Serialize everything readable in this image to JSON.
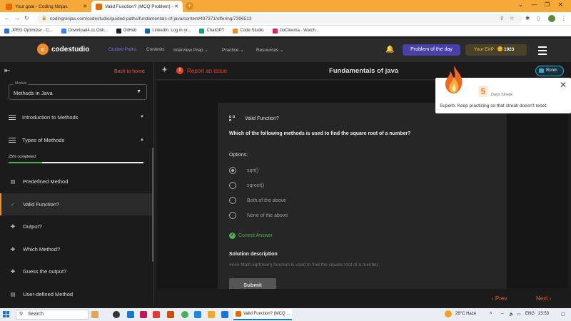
{
  "browser": {
    "tabs": [
      {
        "label": "Your goal - Coding Ninjas"
      },
      {
        "label": "Valid Function? (MCQ Problem) -"
      }
    ],
    "url": "codingninjas.com/codestudio/guided-paths/fundamentals-of-java/content/497371/offering/7396513",
    "bookmarks": [
      {
        "label": "JPEG Optimizer - C...",
        "color": "#2f6fd6"
      },
      {
        "label": "Download4.cc Onli...",
        "color": "#3b82f6"
      },
      {
        "label": "GitHub",
        "color": "#222222"
      },
      {
        "label": "LinkedIn: Log in or...",
        "color": "#0a66c2"
      },
      {
        "label": "ChatGPT",
        "color": "#10a37f"
      },
      {
        "label": "Code Studio",
        "color": "#f08c2a"
      },
      {
        "label": "JioCinema - Watch...",
        "color": "#d6256b"
      }
    ]
  },
  "header": {
    "logo": "codestudio",
    "nav": [
      {
        "label": "Guided Paths"
      },
      {
        "label": "Contests"
      },
      {
        "label": "Interview Prep"
      },
      {
        "label": "Practice"
      },
      {
        "label": "Resources"
      }
    ],
    "potd": "Problem of the day",
    "exp_label": "Your EXP",
    "exp_value": "1923"
  },
  "sidebar": {
    "back": "Back to home",
    "module_label": "Module",
    "module_value": "Methods in Java",
    "sections": [
      {
        "label": "Introduction to Methods"
      },
      {
        "label": "Types of Methods"
      }
    ],
    "progress_text": "25% completed",
    "progress": 0.25,
    "items": [
      {
        "label": "Predefined Method",
        "icon": "document-icon"
      },
      {
        "label": "Valid Function?",
        "icon": "check-icon"
      },
      {
        "label": "Output?",
        "icon": "puzzle-icon"
      },
      {
        "label": "Which Method?",
        "icon": "puzzle-icon"
      },
      {
        "label": "Guess the output?",
        "icon": "puzzle-icon"
      },
      {
        "label": "User-defined Method",
        "icon": "document-icon"
      }
    ]
  },
  "topbar": {
    "report": "Report an issue",
    "title": "Fundamentals of java",
    "user": "Ronin"
  },
  "question": {
    "title": "Valid Function?",
    "text": "Which of the following methods is used to find the square root of a number?",
    "options_label": "Options:",
    "options": [
      {
        "label": "sqrt()",
        "selected": true
      },
      {
        "label": "sqroot()",
        "selected": false
      },
      {
        "label": "Both of the above",
        "selected": false
      },
      {
        "label": "None of the above",
        "selected": false
      }
    ],
    "result": "Correct Answer",
    "solution_title": "Solution description",
    "solution_text": "#### Math.sqrt(num) function is used to find the square root of a number.",
    "submit": "Submit"
  },
  "pager": {
    "prev": "Prev",
    "next": "Next"
  },
  "streak": {
    "days": "5",
    "label": "Days Streak",
    "message": "Superb, Keep practicing so that streak doesn't reset."
  },
  "taskbar": {
    "search": "Search",
    "active_window": "Valid Function? (MCQ ...",
    "weather": "26°C  Haze",
    "lang": "ENG",
    "time": "23:53"
  },
  "colors": {
    "accent": "#f08c2a",
    "report": "#e0472c",
    "success": "#4caf50",
    "potd": "#4a3fa6"
  }
}
